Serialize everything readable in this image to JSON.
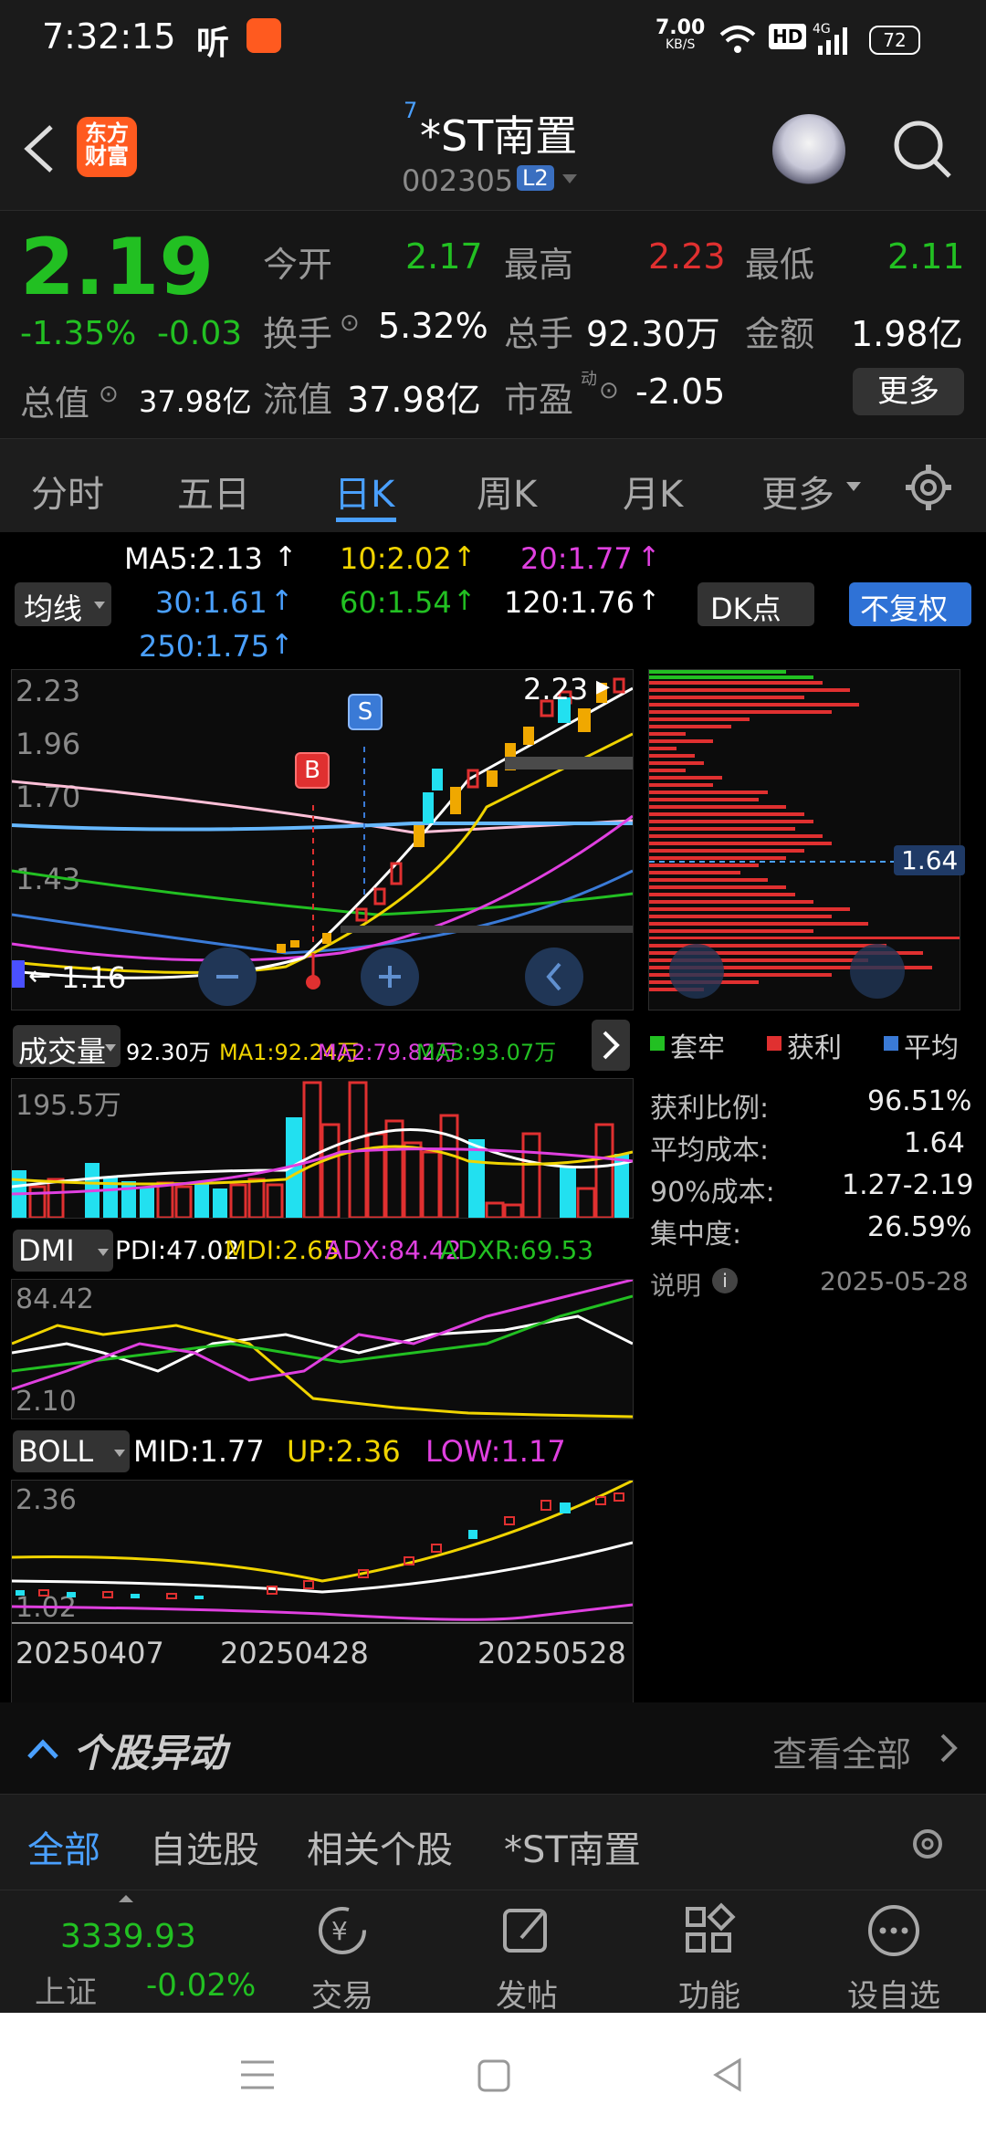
{
  "status_bar": {
    "time": "7:32:15",
    "net_speed_value": "7.00",
    "net_speed_unit": "KB/S",
    "battery": "72"
  },
  "header": {
    "logo_line1": "东方",
    "logo_line2": "财富",
    "name_superscript": "7",
    "stock_name": "*ST南置",
    "stock_code": "002305",
    "l2_badge": "L2"
  },
  "quote": {
    "price": "2.19",
    "change_pct": "-1.35%",
    "change_amt": "-0.03",
    "total_cap_label": "总值",
    "total_cap": "37.98亿",
    "open_label": "今开",
    "open": "2.17",
    "high_label": "最高",
    "high": "2.23",
    "low_label": "最低",
    "low": "2.11",
    "turnover_label": "换手",
    "turnover": "5.32%",
    "volume_label": "总手",
    "volume": "92.30万",
    "amount_label": "金额",
    "amount": "1.98亿",
    "float_cap_label": "流值",
    "float_cap": "37.98亿",
    "pe_label": "市盈",
    "pe_sup": "动",
    "pe": "-2.05",
    "more_button": "更多"
  },
  "tabs": [
    "分时",
    "五日",
    "日K",
    "周K",
    "月K",
    "更多"
  ],
  "active_tab_index": 2,
  "ma": {
    "ma_label": "均线",
    "ma5": "MA5:2.13",
    "ma10": "10:2.02",
    "ma20": "20:1.77",
    "ma30": "30:1.61",
    "ma60": "60:1.54",
    "ma120": "120:1.76",
    "ma250": "250:1.75",
    "dk_button": "DK点",
    "adjust_button": "不复权"
  },
  "kline": {
    "y_top": "2.23",
    "y_mid1": "1.96",
    "y_mid2": "1.70",
    "y_mid3": "1.43",
    "y_bottom": "1.16",
    "high_marker": "2.23",
    "low_marker": "1.16",
    "signal_b": "B",
    "signal_s": "S"
  },
  "chip": {
    "avg_cost_marker": "1.64",
    "legend_trapped": "套牢",
    "legend_profit": "获利",
    "legend_avg": "平均",
    "profit_ratio_label": "获利比例:",
    "profit_ratio": "96.51%",
    "avg_cost_label": "平均成本:",
    "avg_cost": "1.64",
    "cost90_label": "90%成本:",
    "cost90": "1.27-2.19",
    "concentration_label": "集中度:",
    "concentration": "26.59%",
    "note_label": "说明",
    "date": "2025-05-28"
  },
  "volume": {
    "label": "成交量",
    "vol": "92.30万",
    "ma1": "MA1:92.24万",
    "ma2": "MA2:79.82万",
    "ma3": "MA3:93.07万",
    "y_top": "195.5万"
  },
  "dmi": {
    "label": "DMI",
    "pdi": "PDI:47.02",
    "mdi": "MDI:2.65",
    "adx": "ADX:84.42",
    "adxr": "ADXR:69.53",
    "y_top": "84.42",
    "y_bottom": "2.10"
  },
  "boll": {
    "label": "BOLL",
    "mid": "MID:1.77",
    "up": "UP:2.36",
    "low": "LOW:1.17",
    "y_top": "2.36",
    "y_bottom": "1.02"
  },
  "x_axis": [
    "20250407",
    "20250428",
    "20250528"
  ],
  "abnormal": {
    "title": "个股异动",
    "view_all": "查看全部"
  },
  "subtabs": [
    "全部",
    "自选股",
    "相关个股",
    "*ST南置"
  ],
  "bottom_nav": {
    "index_value": "3339.93",
    "index_name": "上证",
    "index_change": "-0.02%",
    "trade": "交易",
    "post": "发帖",
    "functions": "功能",
    "watchlist": "设自选"
  },
  "colors": {
    "up": "#e03030",
    "down": "#22c022",
    "accent": "#4aa0ff",
    "background": "#000000"
  }
}
